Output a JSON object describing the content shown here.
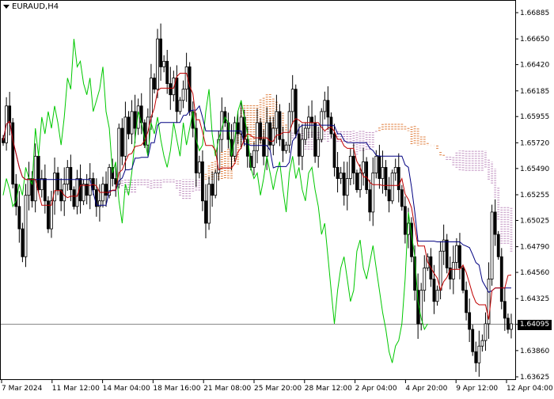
{
  "window": {
    "symbol": "EURAUD,H4",
    "current_price": "1.64095"
  },
  "chart_data": {
    "type": "candlestick",
    "title": "EURAUD,H4",
    "price_ticks": [
      "1.66885",
      "1.66650",
      "1.66420",
      "1.66185",
      "1.65955",
      "1.65720",
      "1.65490",
      "1.65255",
      "1.65025",
      "1.64790",
      "1.64560",
      "1.64325",
      "1.64095",
      "1.63860",
      "1.63625"
    ],
    "time_ticks": [
      "7 Mar 2024",
      "11 Mar 12:00",
      "14 Mar 04:00",
      "18 Mar 16:00",
      "21 Mar 08:00",
      "25 Mar 20:00",
      "28 Mar 12:00",
      "2 Apr 04:00",
      "4 Apr 20:00",
      "9 Apr 12:00",
      "12 Apr 04:00"
    ],
    "ylim": [
      1.63625,
      1.66885
    ],
    "current_price": 1.64095,
    "grid": false,
    "colors": {
      "candle": "#000000",
      "tenkan": "#c00000",
      "kijun": "#000080",
      "chikou": "#00c800",
      "kumo_bull": "#e08040",
      "kumo_bear": "#c090c0",
      "price_line": "#808080"
    },
    "close": [
      1.6572,
      1.6605,
      1.659,
      1.6535,
      1.6515,
      1.6495,
      1.647,
      1.6525,
      1.654,
      1.652,
      1.656,
      1.653,
      1.654,
      1.652,
      1.6495,
      1.652,
      1.6545,
      1.653,
      1.652,
      1.6535,
      1.655,
      1.653,
      1.6515,
      1.654,
      1.652,
      1.6535,
      1.6525,
      1.654,
      1.653,
      1.6515,
      1.652,
      1.6535,
      1.6525,
      1.655,
      1.654,
      1.6535,
      1.6585,
      1.656,
      1.6595,
      1.658,
      1.66,
      1.6585,
      1.6605,
      1.659,
      1.657,
      1.6595,
      1.663,
      1.662,
      1.6665,
      1.664,
      1.6645,
      1.6625,
      1.6615,
      1.663,
      1.66,
      1.661,
      1.662,
      1.664,
      1.66,
      1.6585,
      1.6545,
      1.6555,
      1.652,
      1.65,
      1.6535,
      1.6525,
      1.6545,
      1.6575,
      1.66,
      1.659,
      1.6575,
      1.656,
      1.659,
      1.658,
      1.6595,
      1.6575,
      1.656,
      1.655,
      1.6565,
      1.659,
      1.6575,
      1.656,
      1.659,
      1.657,
      1.6585,
      1.66,
      1.6575,
      1.6565,
      1.657,
      1.66,
      1.662,
      1.658,
      1.656,
      1.6575,
      1.6585,
      1.6595,
      1.659,
      1.656,
      1.6575,
      1.66,
      1.661,
      1.6595,
      1.658,
      1.655,
      1.654,
      1.6545,
      1.6525,
      1.654,
      1.656,
      1.6545,
      1.653,
      1.6545,
      1.6555,
      1.653,
      1.651,
      1.6545,
      1.656,
      1.654,
      1.655,
      1.653,
      1.652,
      1.6545,
      1.655,
      1.653,
      1.6515,
      1.649,
      1.65,
      1.647,
      1.644,
      1.641,
      1.644,
      1.646,
      1.647,
      1.645,
      1.643,
      1.644,
      1.6475,
      1.6485,
      1.646,
      1.645,
      1.6465,
      1.648,
      1.646,
      1.644,
      1.642,
      1.6405,
      1.6385,
      1.6375,
      1.639,
      1.6395,
      1.641,
      1.645,
      1.651,
      1.649,
      1.647,
      1.643,
      1.6415,
      1.6405,
      1.641
    ]
  }
}
